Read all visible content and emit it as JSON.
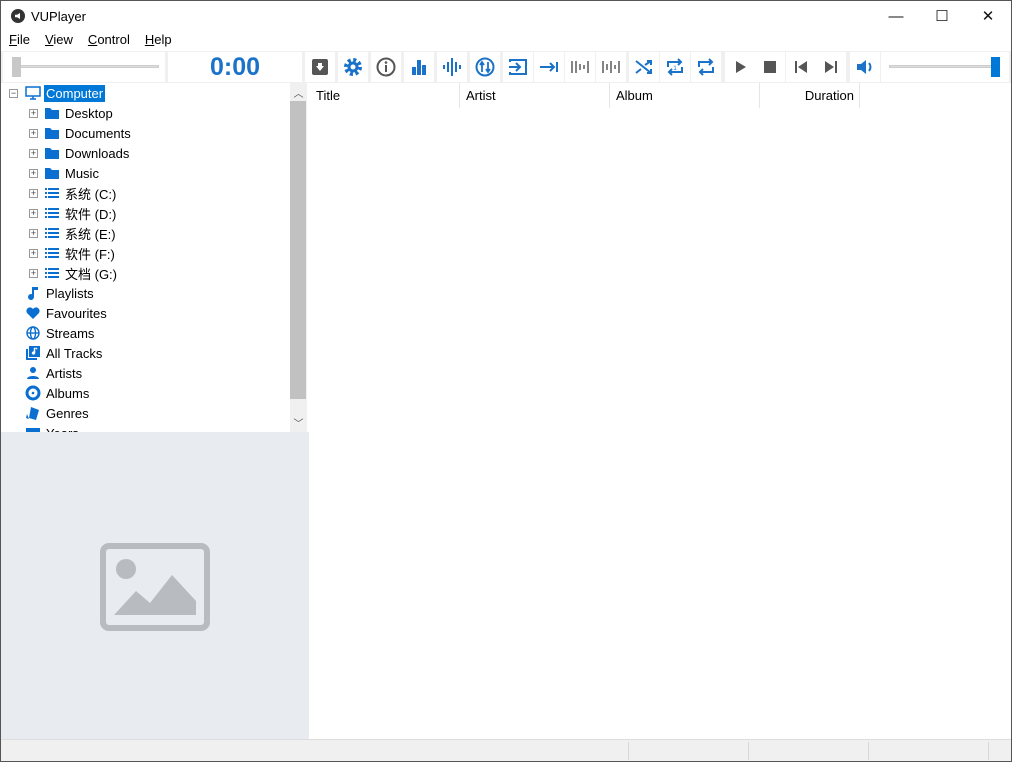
{
  "window": {
    "title": "VUPlayer",
    "minimize": "—",
    "maximize": "☐",
    "close": "✕"
  },
  "menu": [
    {
      "key": "F",
      "rest": "ile"
    },
    {
      "key": "V",
      "rest": "iew"
    },
    {
      "key": "C",
      "rest": "ontrol"
    },
    {
      "key": "H",
      "rest": "elp"
    }
  ],
  "player": {
    "time": "0:00",
    "seek_fraction": 0,
    "volume_fraction": 1.0
  },
  "accent": "#0078d7",
  "tree": {
    "root": "Computer",
    "folders": [
      "Desktop",
      "Documents",
      "Downloads",
      "Music",
      "系统 (C:)",
      "软件 (D:)",
      "系统 (E:)",
      "软件 (F:)",
      "文档 (G:)"
    ],
    "items": [
      "Playlists",
      "Favourites",
      "Streams",
      "All Tracks",
      "Artists",
      "Albums",
      "Genres",
      "Years"
    ]
  },
  "columns": [
    "Title",
    "Artist",
    "Album",
    "Duration"
  ]
}
